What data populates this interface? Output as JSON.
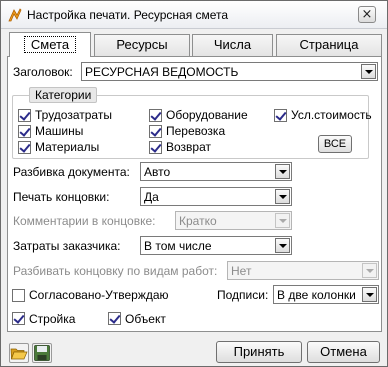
{
  "window": {
    "title": "Настройка печати. Ресурсная смета",
    "close_glyph": "×"
  },
  "tabs": [
    {
      "label": "Смета",
      "active": true
    },
    {
      "label": "Ресурсы",
      "active": false
    },
    {
      "label": "Числа",
      "active": false
    },
    {
      "label": "Страница",
      "active": false
    }
  ],
  "header": {
    "label": "Заголовок:",
    "value": "РЕСУРСНАЯ ВЕДОМОСТЬ"
  },
  "categories": {
    "caption": "Категории",
    "items": [
      {
        "label": "Трудозатраты",
        "checked": true
      },
      {
        "label": "Оборудование",
        "checked": true
      },
      {
        "label": "Усл.стоимость",
        "checked": true
      },
      {
        "label": "Машины",
        "checked": true
      },
      {
        "label": "Перевозка",
        "checked": true
      },
      {
        "label": "Материалы",
        "checked": true
      },
      {
        "label": "Возврат",
        "checked": true
      }
    ],
    "all_button": "ВСЕ"
  },
  "fields": {
    "split": {
      "label": "Разбивка документа:",
      "value": "Авто"
    },
    "print_ending": {
      "label": "Печать концовки:",
      "value": "Да"
    },
    "comments": {
      "label": "Комментарии в концовке:",
      "value": "Кратко"
    },
    "customer_costs": {
      "label": "Затраты заказчика:",
      "value": "В том числе"
    },
    "split_ending": {
      "label": "Разбивать концовку по видам работ:",
      "value": "Нет"
    }
  },
  "approval": {
    "label": "Согласовано-Утверждаю",
    "checked": false
  },
  "signatures": {
    "label": "Подписи:",
    "value": "В две колонки"
  },
  "construction": {
    "label": "Стройка",
    "checked": true
  },
  "object": {
    "label": "Объект",
    "checked": true
  },
  "footer": {
    "accept": "Принять",
    "cancel": "Отмена"
  },
  "colors": {
    "folder": "#e8b830",
    "disk": "#4a7a3a"
  }
}
